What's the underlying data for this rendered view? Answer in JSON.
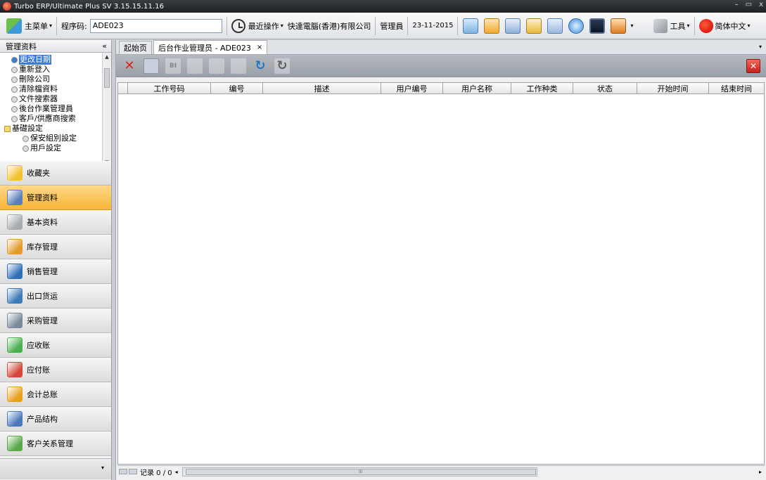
{
  "window": {
    "title": "Turbo ERP/Ultimate Plus SV 3.15.15.11.16",
    "minimize": "–",
    "maximize": "▭",
    "close": "x"
  },
  "toolbar": {
    "main_menu": "主菜单",
    "program_code_label": "程序码:",
    "program_code_value": "ADE023",
    "recent_ops": "最近操作",
    "company": "快達電腦(香港)有限公司",
    "user": "管理員",
    "date": "23-11-2015",
    "tools": "工具",
    "language": "简体中文"
  },
  "left_panel": {
    "header": "管理资料",
    "collapse": "«",
    "tree": [
      {
        "label": "更改日期",
        "kind": "leaf",
        "selected": true
      },
      {
        "label": "重新登入",
        "kind": "leaf"
      },
      {
        "label": "刪除公司",
        "kind": "leaf"
      },
      {
        "label": "清除檔資料",
        "kind": "leaf"
      },
      {
        "label": "文件搜索器",
        "kind": "leaf"
      },
      {
        "label": "後台作業管理員",
        "kind": "leaf"
      },
      {
        "label": "客戶/供應商搜索",
        "kind": "leaf"
      },
      {
        "label": "基礎設定",
        "kind": "folder"
      },
      {
        "label": "保安組別設定",
        "kind": "child"
      },
      {
        "label": "用戶設定",
        "kind": "child"
      }
    ],
    "nav": [
      {
        "label": "收藏夹",
        "icon": "star-icon",
        "color": "#f2c230"
      },
      {
        "label": "管理资料",
        "icon": "admin-user-icon",
        "color": "#5b7fb8",
        "active": true
      },
      {
        "label": "基本资料",
        "icon": "gears-icon",
        "color": "#a7abb0"
      },
      {
        "label": "库存管理",
        "icon": "boxes-icon",
        "color": "#e39b2d"
      },
      {
        "label": "销售管理",
        "icon": "sales-icon",
        "color": "#2f6fb8"
      },
      {
        "label": "出口货运",
        "icon": "anchor-icon",
        "color": "#3c7ab8"
      },
      {
        "label": "采购管理",
        "icon": "purchase-icon",
        "color": "#7a8a99"
      },
      {
        "label": "应收账",
        "icon": "receivable-icon",
        "color": "#4caf50"
      },
      {
        "label": "应付账",
        "icon": "payable-icon",
        "color": "#d6453a"
      },
      {
        "label": "会计总账",
        "icon": "ledger-icon",
        "color": "#e8a020"
      },
      {
        "label": "产品结构",
        "icon": "structure-icon",
        "color": "#4a78b8"
      },
      {
        "label": "客户关系管理",
        "icon": "crm-icon",
        "color": "#5aa84a"
      }
    ],
    "footer_caret": "▾"
  },
  "tabs": [
    {
      "label": "起始页"
    },
    {
      "label": "后台作业管理员 - ADE023",
      "active": true,
      "close": "×"
    }
  ],
  "grid": {
    "columns": [
      "工作号码",
      "编号",
      "描述",
      "用户编号",
      "用户名称",
      "工作种类",
      "状态",
      "开始时间",
      "结束时间"
    ]
  },
  "status": {
    "records": "记录 0 / 0",
    "scroll_mark": "III"
  }
}
